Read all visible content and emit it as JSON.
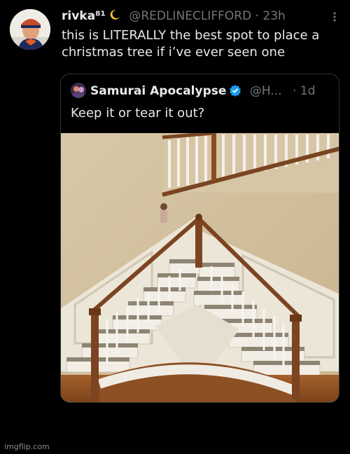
{
  "tweet": {
    "display_name": "rivka⁸¹",
    "handle": "@REDLINECLIFFORD",
    "separator": "·",
    "time": "23h",
    "text": "this is LITERALLY the best spot to place a christmas tree if i’ve ever seen one"
  },
  "quote": {
    "display_name": "Samurai Apocalypse",
    "handle": "@H...",
    "separator": "·",
    "time": "1d",
    "text": "Keep it or tear it out?"
  },
  "icons": {
    "avatar": "avatar-photo",
    "moon": "crescent-moon-icon",
    "more": "more-options-icon",
    "verified": "verified-badge-icon"
  },
  "colors": {
    "background": "#000000",
    "text_primary": "#e7e9ea",
    "text_secondary": "#71767b",
    "verified_blue": "#1d9bf0",
    "card_border": "#2f3336"
  },
  "watermark": "imgflip.com"
}
